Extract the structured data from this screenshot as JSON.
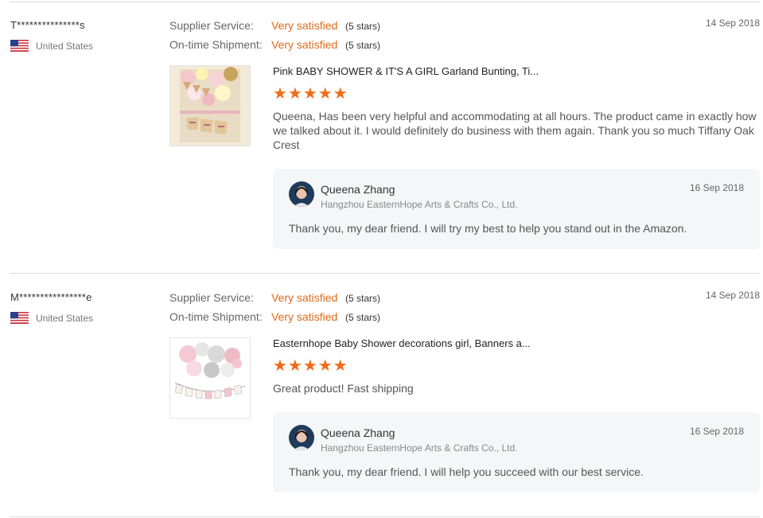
{
  "reviews": [
    {
      "buyer": "T***************s",
      "country": "United States",
      "date": "14 Sep 2018",
      "ratings": [
        {
          "label": "Supplier Service:",
          "value": "Very satisfied",
          "stars_text": "(5 stars)"
        },
        {
          "label": "On-time Shipment:",
          "value": "Very satisfied",
          "stars_text": "(5 stars)"
        }
      ],
      "product_title": "Pink BABY SHOWER & IT'S A GIRL Garland Bunting, Ti...",
      "stars": "★★★★★",
      "text": "Queena, Has been very helpful and accommodating at all hours. The product came in exactly how we talked about it. I would definitely do business with them again. Thank you so much Tiffany Oak Crest",
      "reply": {
        "seller": "Queena Zhang",
        "company": "Hangzhou EasternHope Arts & Crafts Co., Ltd.",
        "date": "16 Sep 2018",
        "text": "Thank you, my dear friend. I will try my best to help you stand out in the Amazon."
      }
    },
    {
      "buyer": "M****************e",
      "country": "United States",
      "date": "14 Sep 2018",
      "ratings": [
        {
          "label": "Supplier Service:",
          "value": "Very satisfied",
          "stars_text": "(5 stars)"
        },
        {
          "label": "On-time Shipment:",
          "value": "Very satisfied",
          "stars_text": "(5 stars)"
        }
      ],
      "product_title": "Easternhope Baby Shower decorations girl, Banners a...",
      "stars": "★★★★★",
      "text": "Great product! Fast shipping",
      "reply": {
        "seller": "Queena Zhang",
        "company": "Hangzhou EasternHope Arts & Crafts Co., Ltd.",
        "date": "16 Sep 2018",
        "text": "Thank you, my dear friend. I will help you succeed with our best service."
      }
    }
  ],
  "colors": {
    "accent": "#e06a1a",
    "star": "#f06b16",
    "reply_bg": "#f5f6f8"
  }
}
